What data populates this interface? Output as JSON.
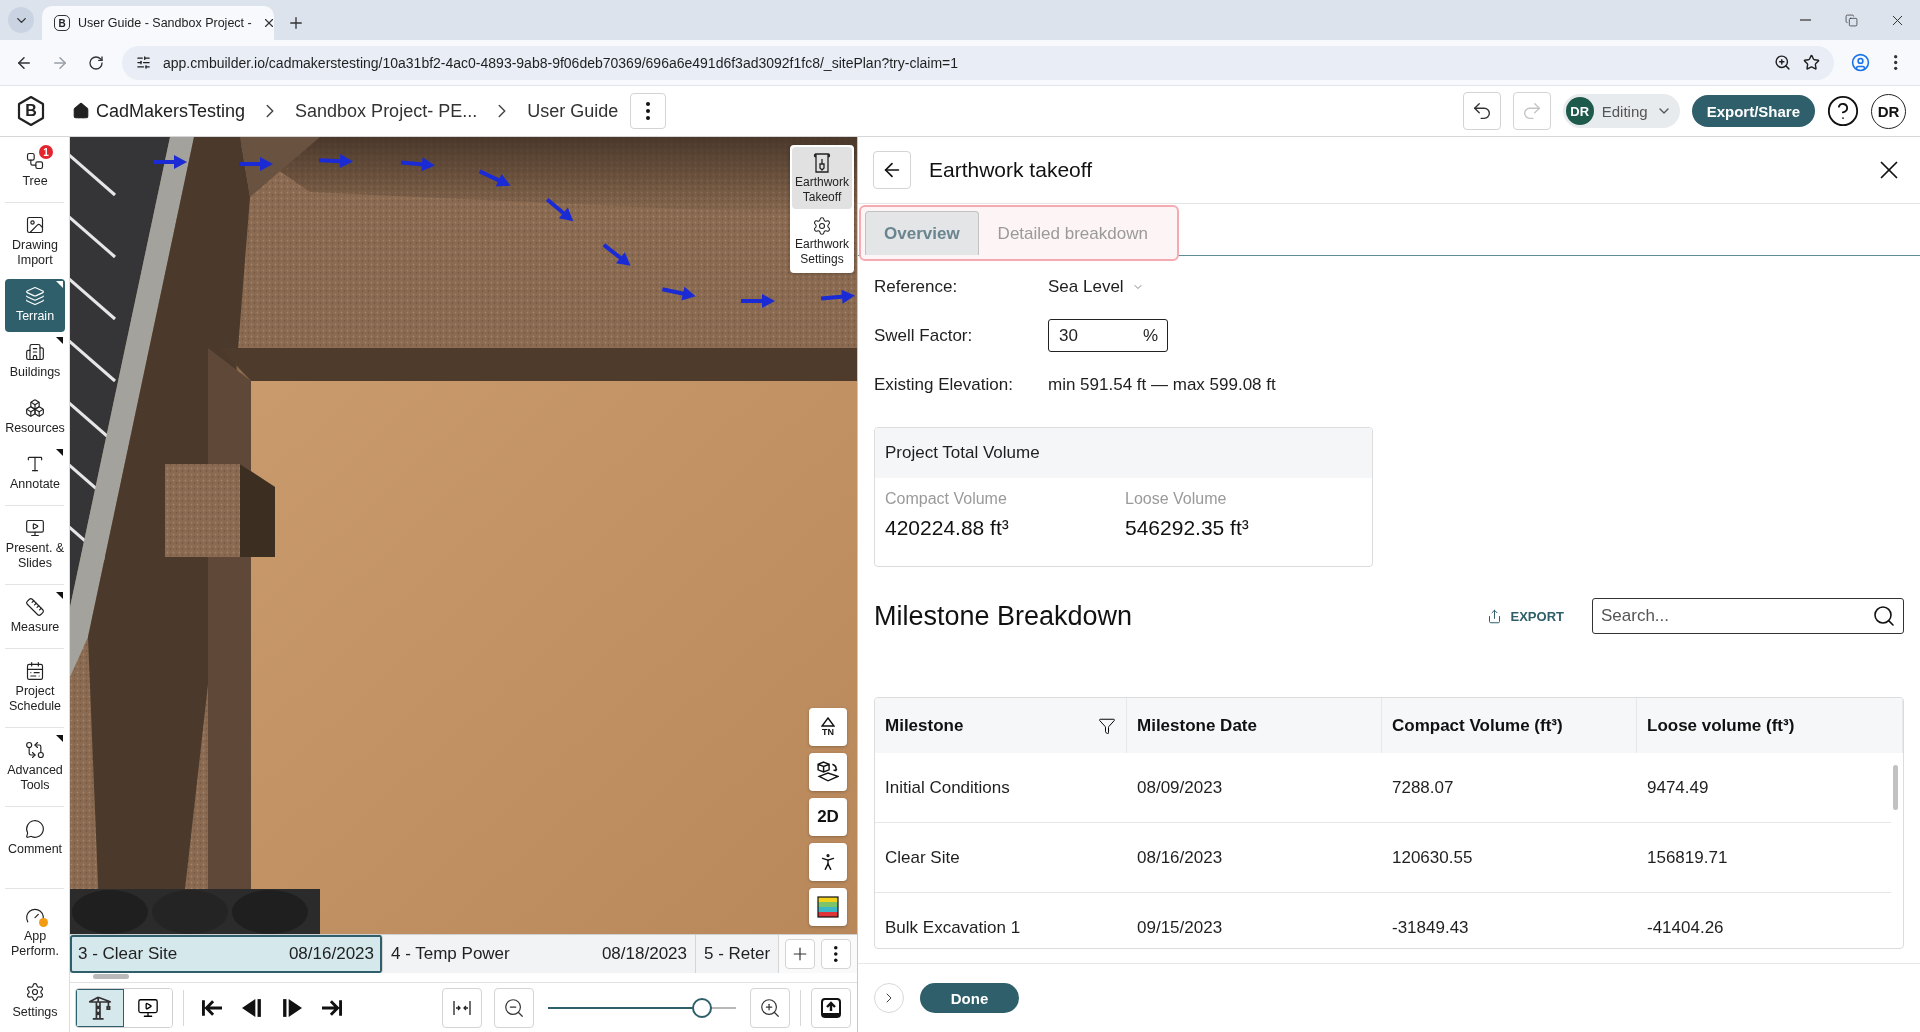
{
  "browser": {
    "tab": {
      "favicon": "B",
      "title": "User Guide - Sandbox Project -"
    },
    "url": "app.cmbuilder.io/cadmakerstesting/10a31bf2-4ac0-4893-9ab8-9f06deb70369/696a6e491d6f3ad3092f1fc8/_sitePlan?try-claim=1"
  },
  "app_bar": {
    "logo": "B",
    "breadcrumbs": [
      {
        "kind": "home",
        "label": "CadMakersTesting"
      },
      {
        "kind": "page",
        "label": "Sandbox Project- PE..."
      },
      {
        "kind": "page",
        "label": "User Guide"
      }
    ],
    "undo": {
      "disabled": false
    },
    "redo": {
      "disabled": true
    },
    "mode": {
      "initials": "DR",
      "label": "Editing"
    },
    "export_button": "Export/Share",
    "account": {
      "initials": "DR"
    }
  },
  "sidebar": {
    "groups": [
      {
        "items": [
          {
            "label": "Tree",
            "selected": false,
            "flyout": false,
            "badge": "1"
          }
        ]
      },
      {
        "items": [
          {
            "label": "Drawing Import",
            "selected": false,
            "flyout": false
          },
          {
            "label": "Terrain",
            "selected": true,
            "flyout": true
          },
          {
            "label": "Buildings",
            "selected": false,
            "flyout": true
          },
          {
            "label": "Resources",
            "selected": false,
            "flyout": false
          },
          {
            "label": "Annotate",
            "selected": false,
            "flyout": true
          }
        ]
      },
      {
        "items": [
          {
            "label": "Present. & Slides",
            "selected": false,
            "flyout": false
          }
        ]
      },
      {
        "items": [
          {
            "label": "Measure",
            "selected": false,
            "flyout": true
          }
        ]
      },
      {
        "items": [
          {
            "label": "Project Schedule",
            "selected": false,
            "flyout": false
          }
        ]
      },
      {
        "items": [
          {
            "label": "Advanced Tools",
            "selected": false,
            "flyout": true
          }
        ]
      },
      {
        "items": [
          {
            "label": "Comment",
            "selected": false,
            "flyout": false
          }
        ]
      }
    ],
    "bottom_items": [
      {
        "label": "App Perform.",
        "selected": false,
        "alert": true
      },
      {
        "label": "Settings",
        "selected": false,
        "alert": false
      }
    ]
  },
  "map": {
    "earthwork_tools": [
      {
        "label": "Earthwork Takeoff",
        "selected": true
      },
      {
        "label": "Earthwork Settings",
        "selected": false
      }
    ],
    "view_controls": [
      {
        "kind": "north",
        "label": "TN"
      },
      {
        "kind": "cube"
      },
      {
        "kind": "text",
        "label": "2D"
      },
      {
        "kind": "person"
      },
      {
        "kind": "layers"
      }
    ],
    "milestones": [
      {
        "label": "3 - Clear Site",
        "date": "08/16/2023",
        "selected": true
      },
      {
        "label": "4 - Temp Power",
        "date": "08/18/2023",
        "selected": false
      },
      {
        "label": "5 - Reter",
        "selected": false
      }
    ],
    "view_modes": [
      {
        "kind": "crane",
        "selected": true
      },
      {
        "kind": "presentation",
        "selected": false
      }
    ],
    "zoom": {
      "level": 0.82
    }
  },
  "panel": {
    "title": "Earthwork takeoff",
    "tabs_highlighted": true,
    "tabs": [
      {
        "label": "Overview",
        "selected": true
      },
      {
        "label": "Detailed breakdown",
        "selected": false
      }
    ],
    "fields": [
      {
        "kind": "select",
        "label": "Reference:",
        "value": "Sea Level"
      },
      {
        "kind": "input",
        "label": "Swell Factor:",
        "value": "30",
        "unit": "%"
      },
      {
        "kind": "text",
        "label": "Existing Elevation:",
        "value": "min 591.54 ft — max 599.08 ft"
      }
    ],
    "total_volume": {
      "title": "Project Total Volume",
      "metrics": [
        {
          "label": "Compact Volume",
          "value": "420224.88 ft³"
        },
        {
          "label": "Loose Volume",
          "value": "546292.35 ft³"
        }
      ]
    },
    "breakdown": {
      "title": "Milestone Breakdown",
      "export": "EXPORT",
      "search": {
        "placeholder": "Search..."
      },
      "table": {
        "columns": [
          {
            "label": "Milestone",
            "filter": true
          },
          {
            "label": "Milestone Date",
            "filter": false
          },
          {
            "label": "Compact Volume (ft³)",
            "filter": false
          },
          {
            "label": "Loose volume (ft³)",
            "filter": false
          }
        ],
        "rows": [
          [
            "Initial Conditions",
            "08/09/2023",
            "7288.07",
            "9474.49"
          ],
          [
            "Clear Site",
            "08/16/2023",
            "120630.55",
            "156819.71"
          ],
          [
            "Bulk Excavation 1",
            "09/15/2023",
            "-31849.43",
            "-41404.26"
          ]
        ]
      }
    },
    "done_button": "Done"
  }
}
